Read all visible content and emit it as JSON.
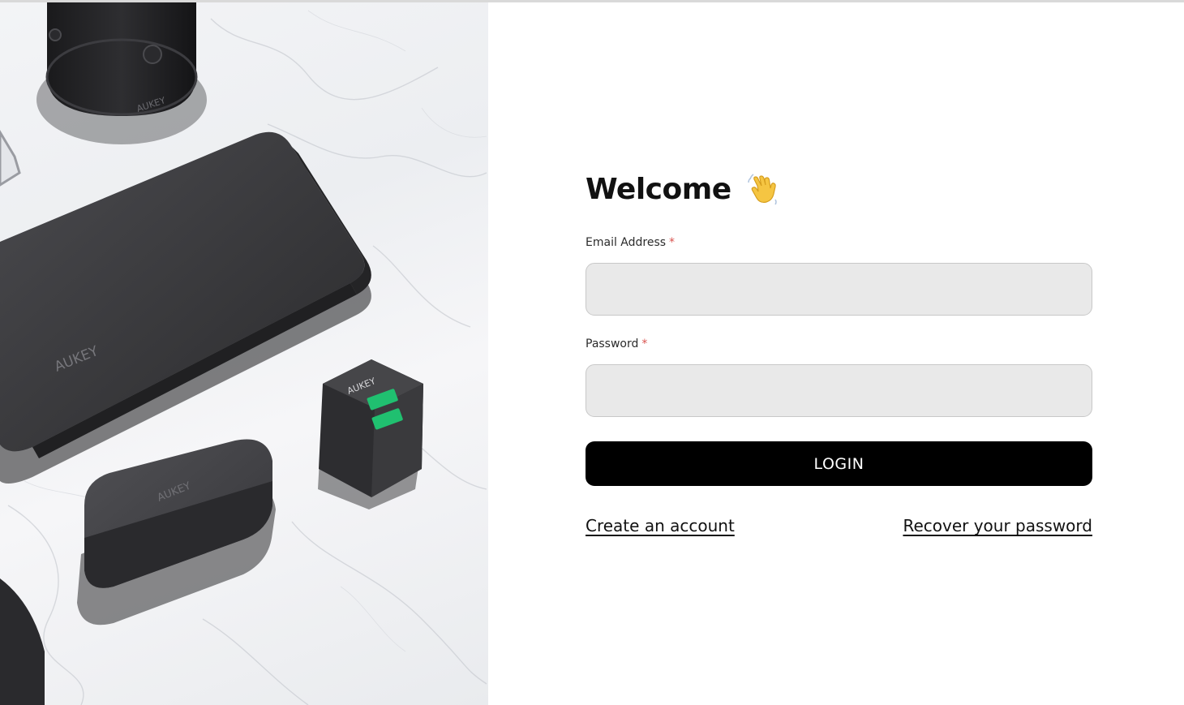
{
  "hero": {
    "brand_label": "AUKEY"
  },
  "login": {
    "title": "Welcome",
    "title_icon": "waving-hand-icon",
    "email_label": "Email Address",
    "email_value": "",
    "password_label": "Password",
    "password_value": "",
    "required_marker": "*",
    "login_label": "LOGIN",
    "create_account_label": "Create an account",
    "recover_password_label": "Recover your password"
  },
  "colors": {
    "button_background": "#000000",
    "button_text": "#ffffff",
    "input_background": "#e9e9e9",
    "input_border": "#c8c8c8",
    "required_marker": "#d9534f",
    "text": "#111111"
  }
}
